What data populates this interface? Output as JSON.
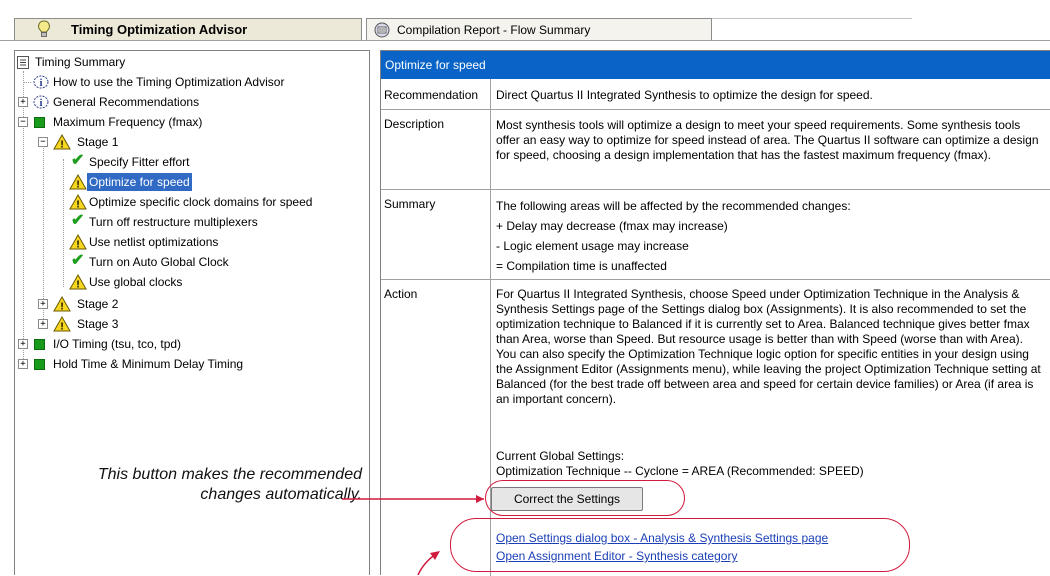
{
  "tabs": {
    "active": "Timing Optimization Advisor",
    "other": "Compilation Report - Flow Summary"
  },
  "tree": {
    "root": "Timing Summary",
    "how_to": "How to use the Timing Optimization Advisor",
    "general": "General Recommendations",
    "fmax": "Maximum Frequency (fmax)",
    "stage1": "Stage 1",
    "items": [
      "Specify Fitter effort",
      "Optimize for speed",
      "Optimize specific clock domains for speed",
      "Turn off restructure multiplexers",
      "Use netlist optimizations",
      "Turn on Auto Global Clock",
      "Use global clocks"
    ],
    "stage2": "Stage 2",
    "stage3": "Stage 3",
    "io_timing": "I/O Timing (tsu, tco, tpd)",
    "hold_time": "Hold Time & Minimum Delay Timing"
  },
  "panel": {
    "title": "Optimize for speed",
    "labels": {
      "recommendation": "Recommendation",
      "description": "Description",
      "summary": "Summary",
      "action": "Action"
    },
    "recommendation": "Direct Quartus II Integrated Synthesis to optimize the design for speed.",
    "description": "Most synthesis tools will optimize a design to meet your speed requirements. Some synthesis tools offer an easy way to optimize for speed instead of area. The Quartus II software can optimize a design for speed, choosing a design implementation that has the fastest maximum frequency (fmax).",
    "summary": {
      "intro": "The following areas will be affected by the recommended changes:",
      "line1": "+ Delay may decrease (fmax may increase)",
      "line2": "- Logic element usage may increase",
      "line3": "= Compilation time is unaffected"
    },
    "action": "For Quartus II Integrated Synthesis, choose Speed under Optimization Technique in the Analysis & Synthesis Settings page of the Settings dialog box (Assignments). It is also recommended to set the optimization technique to Balanced if it is currently set to Area. Balanced technique gives better fmax than Area, worse than Speed. But resource usage is better than with Speed (worse than with Area). You can also specify the Optimization Technique logic option for specific entities in your design using the Assignment Editor (Assignments menu), while leaving the project Optimization Technique setting at Balanced (for the best trade off between area and speed for certain device families) or Area (if area is an important concern).",
    "current_settings_label": "Current Global Settings:",
    "current_settings_value": "Optimization Technique -- Cyclone = AREA  (Recommended: SPEED)",
    "button": "Correct the Settings",
    "link1": "Open Settings dialog box - Analysis & Synthesis Settings page",
    "link2": "Open Assignment Editor - Synthesis category"
  },
  "annotation": {
    "line1": "This button makes the recommended",
    "line2": "changes automatically."
  },
  "colors": {
    "header_blue": "#0a64c8",
    "annotation_red": "#d21a3e",
    "selection": "#316ac5",
    "link": "#1b3fb6"
  }
}
